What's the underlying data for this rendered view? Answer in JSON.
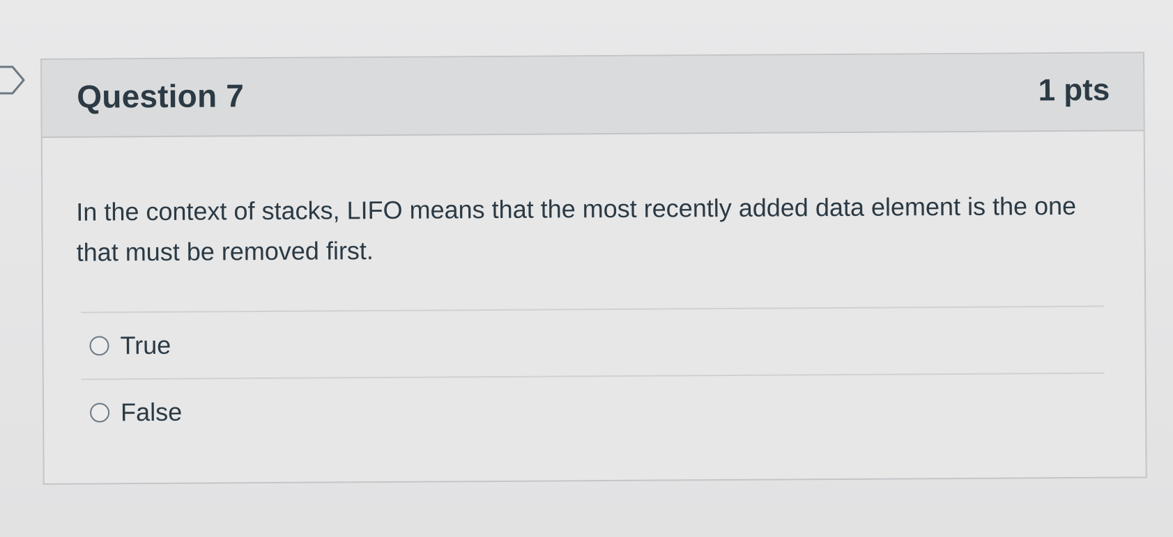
{
  "question": {
    "title": "Question 7",
    "points": "1 pts",
    "text": "In the context of stacks, LIFO means that the most recently added data element is the one that must be removed first."
  },
  "answers": [
    {
      "label": "True",
      "selected": false
    },
    {
      "label": "False",
      "selected": false
    }
  ],
  "colors": {
    "header_background": "#dadbdc",
    "card_background": "#e7e7e8",
    "text": "#2b3a44",
    "border": "#c3c5c8"
  },
  "icons": {
    "flag": "question-flag-icon",
    "radio": "radio-button-icon"
  }
}
